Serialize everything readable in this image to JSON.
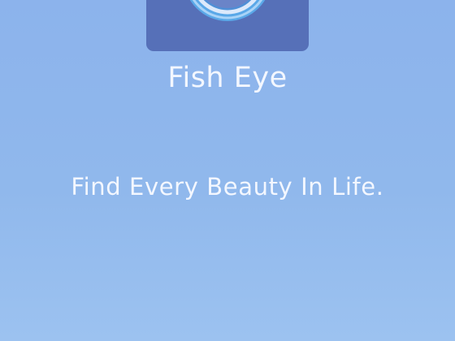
{
  "app": {
    "name": "Fish Eye",
    "tagline": "Find Every Beauty In Life.",
    "icon": "camera-lens-icon"
  },
  "colors": {
    "background_top": "#8cb3ec",
    "background_bottom": "#9cc2f0",
    "icon_background": "#5670b8",
    "lens_ring": "#5aa8e8",
    "lens_rim": "#d9e7fa",
    "text": "#f3f7ff"
  }
}
